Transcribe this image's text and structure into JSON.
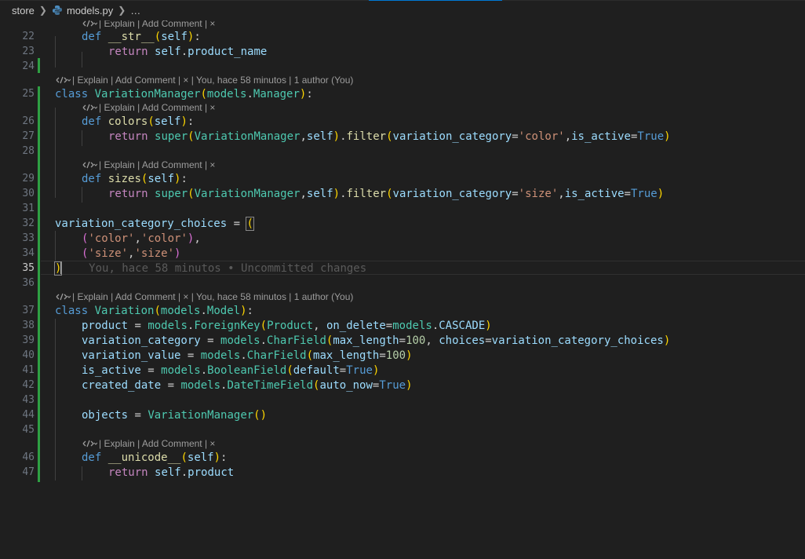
{
  "breadcrumb": {
    "folder": "store",
    "file": "models.py",
    "more": "…",
    "file_icon": "python-icon",
    "sep_icon": "chevron-right-icon"
  },
  "lens": {
    "explain_only": "| Explain | Add Comment | ×",
    "with_author": "| Explain | Add Comment | × | You, hace 58 minutos | 1 author (You)"
  },
  "ghost": {
    "line35": "You, hace 58 minutos • Uncommitted changes"
  },
  "lines": {
    "l22": {
      "num": "22"
    },
    "l23": {
      "num": "23"
    },
    "l24": {
      "num": "24"
    },
    "l25": {
      "num": "25"
    },
    "l26": {
      "num": "26"
    },
    "l27": {
      "num": "27"
    },
    "l28": {
      "num": "28"
    },
    "l29": {
      "num": "29"
    },
    "l30": {
      "num": "30"
    },
    "l31": {
      "num": "31"
    },
    "l32": {
      "num": "32"
    },
    "l33": {
      "num": "33"
    },
    "l34": {
      "num": "34"
    },
    "l35": {
      "num": "35"
    },
    "l36": {
      "num": "36"
    },
    "l37": {
      "num": "37"
    },
    "l38": {
      "num": "38"
    },
    "l39": {
      "num": "39"
    },
    "l40": {
      "num": "40"
    },
    "l41": {
      "num": "41"
    },
    "l42": {
      "num": "42"
    },
    "l43": {
      "num": "43"
    },
    "l44": {
      "num": "44"
    },
    "l45": {
      "num": "45"
    },
    "l46": {
      "num": "46"
    },
    "l47": {
      "num": "47"
    }
  },
  "tok": {
    "def": "def",
    "class": "class",
    "return": "return",
    "self": "self",
    "super": "super",
    "true": "True",
    "str_fn": "__str__",
    "product_name": "product_name",
    "VariationManager": "VariationManager",
    "models": "models",
    "Manager": "Manager",
    "colors": "colors",
    "sizes": "sizes",
    "filter": "filter",
    "variation_category": "variation_category",
    "is_active": "is_active",
    "color_q": "'color'",
    "size_q": "'size'",
    "variation_category_choices": "variation_category_choices",
    "Variation": "Variation",
    "Model": "Model",
    "product": "product",
    "ForeignKey": "ForeignKey",
    "Product": "Product",
    "on_delete": "on_delete",
    "CASCADE": "CASCADE",
    "CharField": "CharField",
    "max_length": "max_length",
    "n100": "100",
    "choices": "choices",
    "variation_value": "variation_value",
    "BooleanField": "BooleanField",
    "default": "default",
    "created_date": "created_date",
    "DateTimeField": "DateTimeField",
    "auto_now": "auto_now",
    "objects": "objects",
    "unicode_fn": "__unicode__"
  },
  "colors": {
    "added_bar": "#2ea043",
    "background": "#1f1f1f",
    "keyword": "#569cd6",
    "string": "#ce9178",
    "class_name": "#4ec9b0"
  }
}
